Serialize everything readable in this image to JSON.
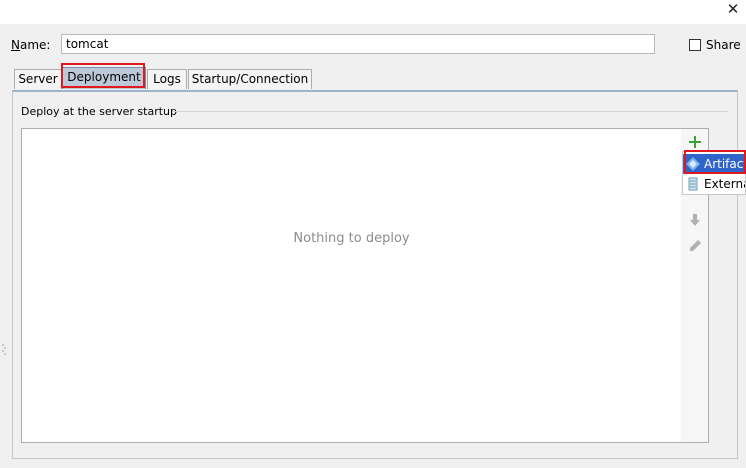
{
  "window": {
    "close_glyph": "✕"
  },
  "name_field": {
    "label": "Name:",
    "mnemonic": "N",
    "label_rest": "ame:",
    "value": "tomcat"
  },
  "share": {
    "label": "Share",
    "checked": false
  },
  "tabs": [
    {
      "label": "Server",
      "selected": false
    },
    {
      "label": "Deployment",
      "selected": true
    },
    {
      "label": "Logs",
      "selected": false
    },
    {
      "label": "Startup/Connection",
      "selected": false
    }
  ],
  "deployment": {
    "section_title": "Deploy at the server startup",
    "empty_text": "Nothing to deploy"
  },
  "toolbar": {
    "icons": [
      "add-icon",
      "move-down-icon",
      "edit-icon"
    ],
    "add_color": "#3aa239"
  },
  "add_popup": {
    "items": [
      {
        "label": "Artifact",
        "icon": "artifact-icon",
        "selected": true
      },
      {
        "label": "External",
        "icon": "external-source-icon",
        "selected": false
      }
    ]
  },
  "colors": {
    "selection": "#2f65ca",
    "highlight_box": "#e0191f",
    "tab_selected": "#bcc9d9"
  }
}
